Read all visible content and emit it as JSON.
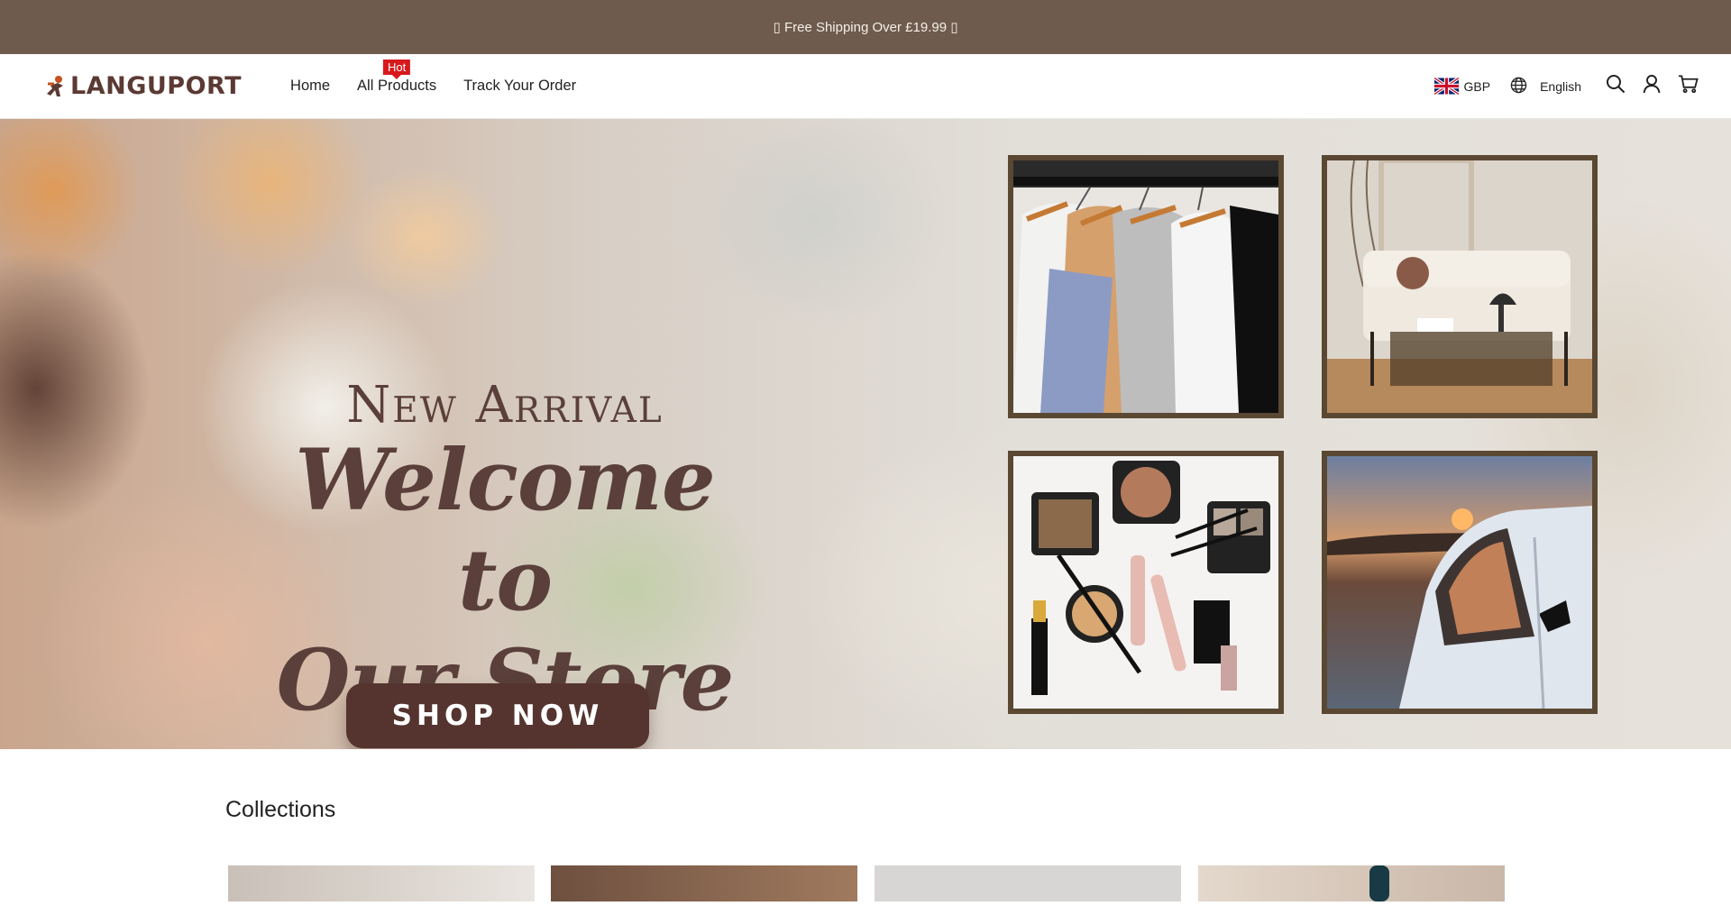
{
  "announcement": {
    "text": "▯ Free Shipping Over £19.99 ▯"
  },
  "header": {
    "logo_text": "LANGUPORT",
    "nav": [
      {
        "label": "Home"
      },
      {
        "label": "All Products",
        "badge": "Hot"
      },
      {
        "label": "Track Your Order"
      }
    ],
    "currency": "GBP",
    "language": "English"
  },
  "hero": {
    "line1": "New Arrival",
    "line2": "Welcome to",
    "line3": "Our Store",
    "cta": "SHOP NOW",
    "tiles": [
      "clothing-rack",
      "living-room-sofa",
      "makeup-cosmetics",
      "car-sunset"
    ]
  },
  "collections": {
    "title": "Collections"
  },
  "colors": {
    "announcement_bg": "#6e5b4d",
    "brand_brown": "#5a3f3a",
    "hot_badge": "#d7191d",
    "tile_border": "#5a4832"
  },
  "icons": [
    "globe-icon",
    "search-icon",
    "account-icon",
    "cart-icon",
    "uk-flag-icon"
  ]
}
